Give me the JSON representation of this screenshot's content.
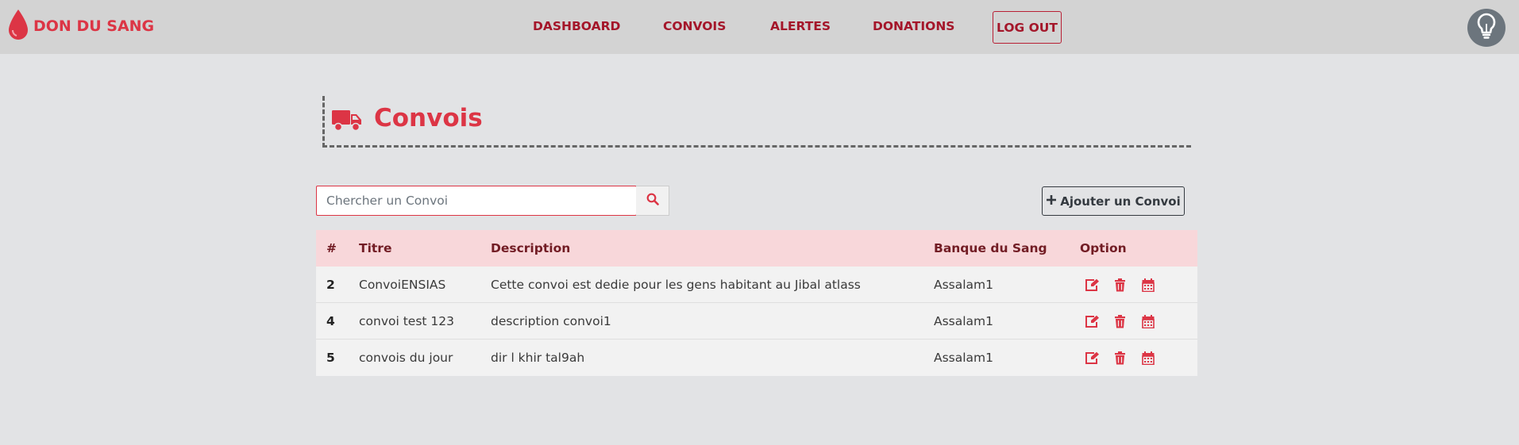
{
  "navbar": {
    "brand": "DON DU SANG",
    "links": [
      {
        "label": "DASHBOARD"
      },
      {
        "label": "CONVOIS"
      },
      {
        "label": "ALERTES"
      },
      {
        "label": "DONATIONS"
      }
    ],
    "logout_label": "LOG OUT",
    "icons": {
      "brand": "blood-drop-icon",
      "theme": "lightbulb-icon"
    }
  },
  "page": {
    "title": "Convois",
    "title_icon": "truck-icon"
  },
  "search": {
    "placeholder": "Chercher un Convoi",
    "value": "",
    "icon": "search-icon"
  },
  "add_button": {
    "label": "Ajouter un Convoi",
    "icon": "plus-icon"
  },
  "table": {
    "headers": [
      "#",
      "Titre",
      "Description",
      "Banque du Sang",
      "Option"
    ],
    "rows": [
      {
        "id": "2",
        "titre": "ConvoiENSIAS",
        "description": "Cette convoi est dedie pour les gens habitant au Jibal atlass",
        "banque": "Assalam1"
      },
      {
        "id": "4",
        "titre": "convoi test 123",
        "description": "description convoi1",
        "banque": "Assalam1"
      },
      {
        "id": "5",
        "titre": "convois du jour",
        "description": "dir l khir tal9ah",
        "banque": "Assalam1"
      }
    ],
    "row_actions": [
      "edit-icon",
      "trash-icon",
      "calendar-icon"
    ]
  },
  "colors": {
    "accent": "#dc3545",
    "nav_text": "#a4162a",
    "navbar_bg": "#d3d3d3",
    "page_bg": "#e2e3e5",
    "table_header_bg": "#f8d7da",
    "table_header_text": "#721c24",
    "row_bg": "#f2f2f2"
  }
}
